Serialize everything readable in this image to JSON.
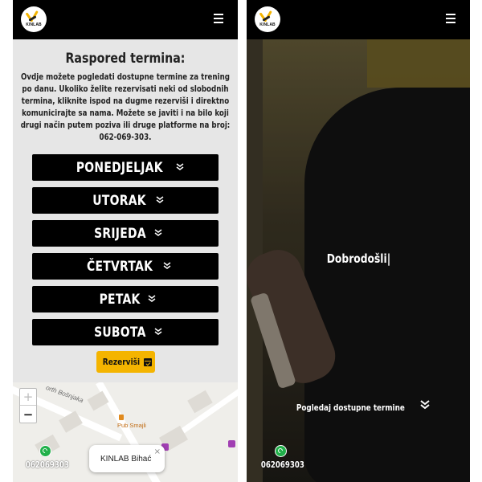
{
  "left": {
    "logo_text": "KINLAB",
    "schedule": {
      "title": "Raspored termina:",
      "description_prefix": "Ovdje možete pogledati dostupne termine za trening po danu. Ukoliko želite rezervisati neki od slobodnih termina, kliknite ispod na dugme rezerviši i direktno komunicirajte sa nama. Možete se javiti i na bilo koji drugi način putem poziva ili druge platforme na broj:",
      "phone_bold": "062-069-303."
    },
    "days": [
      "PONEDJELJAK",
      "UTORAK",
      "SRIJEDA",
      "ČETVRTAK",
      "PETAK",
      "SUBOTA"
    ],
    "reserve_label": "Rezerviši",
    "map": {
      "street": "orth Bošnjaka",
      "zoom_in": "+",
      "zoom_out": "−",
      "poi": "Pub Smajli",
      "popup": "KINLAB Bihać",
      "popup_close": "×"
    },
    "whatsapp_number": "062069303"
  },
  "right": {
    "logo_text": "KINLAB",
    "welcome": "Dobrodošli|",
    "cta": "Pogledaj dostupne termine",
    "whatsapp_number": "062069303"
  },
  "colors": {
    "accent": "#f4b400",
    "bar": "#000000",
    "whatsapp": "#21b04a"
  },
  "icons": [
    "menu-icon",
    "chevron-double-down-icon",
    "calendar-check-icon",
    "whatsapp-icon",
    "close-icon"
  ]
}
